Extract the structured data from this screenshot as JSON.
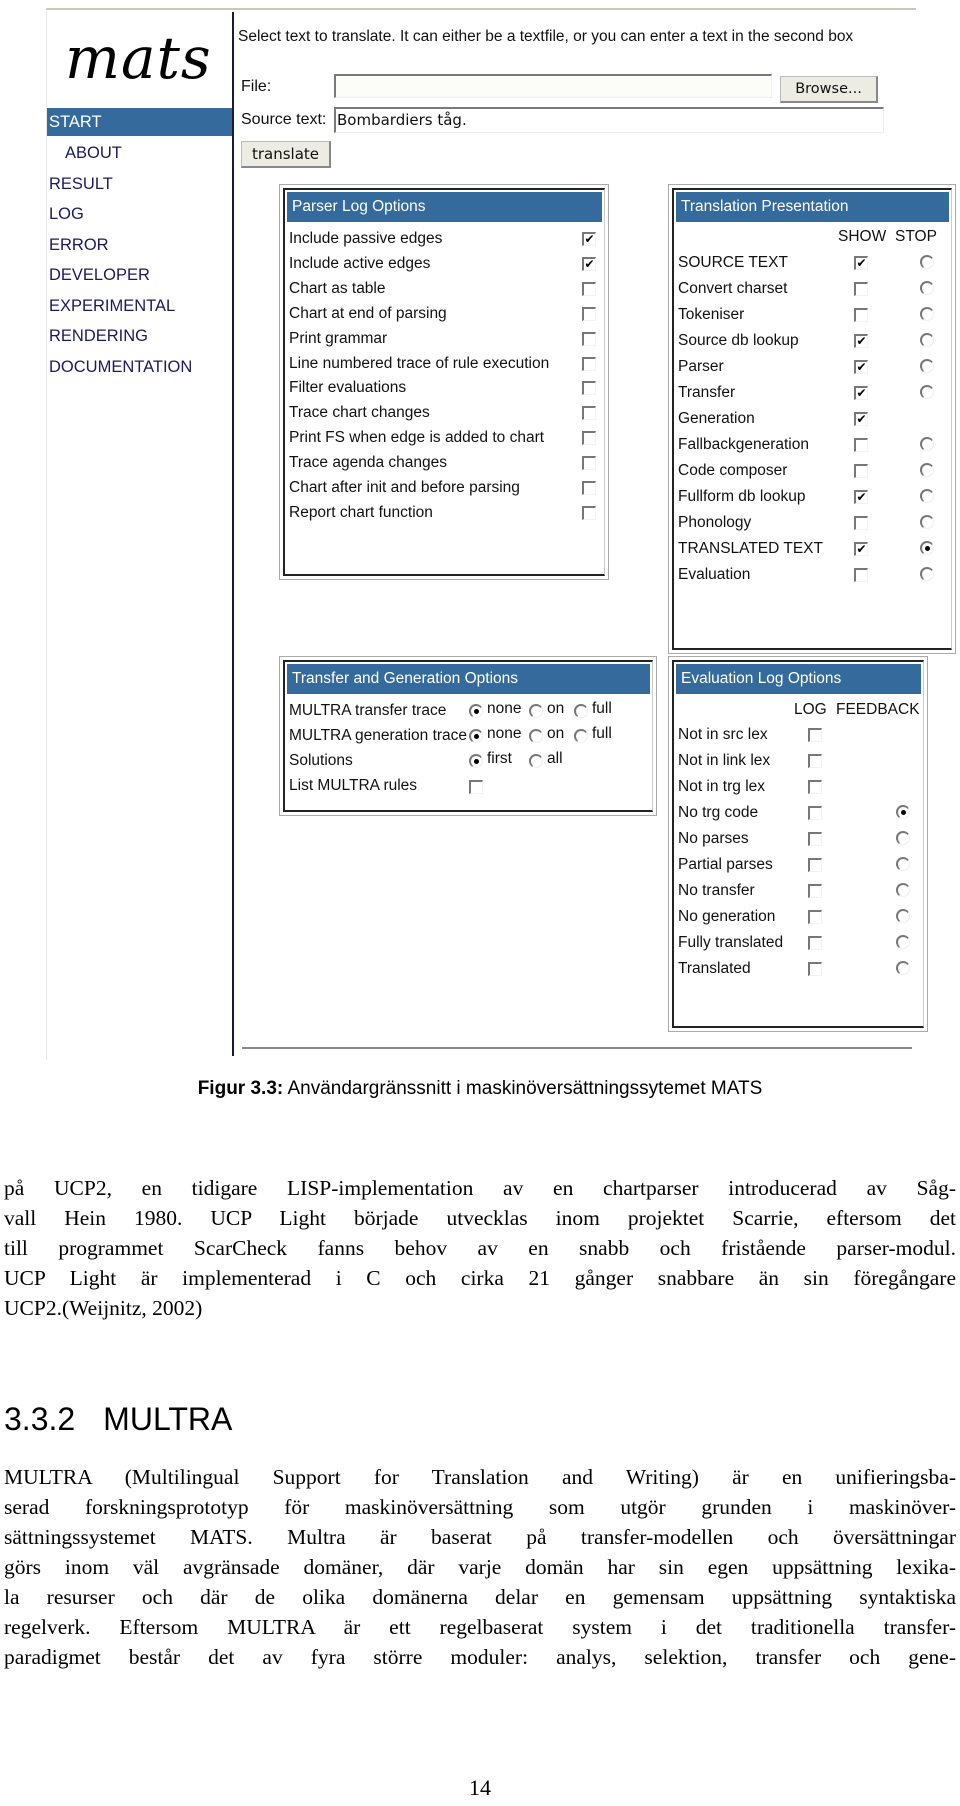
{
  "app": {
    "logo": "mats",
    "nav": [
      {
        "label": "START",
        "active": true
      },
      {
        "label": "ABOUT",
        "indent": true
      },
      {
        "label": "RESULT"
      },
      {
        "label": "LOG"
      },
      {
        "label": "ERROR"
      },
      {
        "label": "DEVELOPER"
      },
      {
        "label": "EXPERIMENTAL"
      },
      {
        "label": "RENDERING"
      },
      {
        "label": "DOCUMENTATION"
      }
    ],
    "intro": "Select text to translate. It can either be a textfile, or you can enter a text in the second box",
    "file_label": "File:",
    "file_value": "",
    "browse_label": "Browse...",
    "source_label": "Source text:",
    "source_value": "Bombardiers tåg.",
    "translate_label": "translate",
    "parser_log": {
      "title": "Parser Log Options",
      "items": [
        {
          "label": "Include passive edges",
          "checked": true
        },
        {
          "label": "Include active edges",
          "checked": true
        },
        {
          "label": "Chart as table",
          "checked": false
        },
        {
          "label": "Chart at end of parsing",
          "checked": false
        },
        {
          "label": "Print grammar",
          "checked": false
        },
        {
          "label": "Line numbered trace of rule execution",
          "checked": false
        },
        {
          "label": "Filter evaluations",
          "checked": false
        },
        {
          "label": "Trace chart changes",
          "checked": false
        },
        {
          "label": "Print FS when edge is added to chart",
          "checked": false
        },
        {
          "label": "Trace agenda changes",
          "checked": false
        },
        {
          "label": "Chart after init and before parsing",
          "checked": false
        },
        {
          "label": "Report chart function",
          "checked": false
        }
      ]
    },
    "translation_presentation": {
      "title": "Translation Presentation",
      "col_show": "SHOW",
      "col_stop": "STOP",
      "items": [
        {
          "label": "SOURCE TEXT",
          "show": true,
          "stop": false,
          "has_stop": true
        },
        {
          "label": "Convert charset",
          "show": false,
          "stop": false,
          "has_stop": true
        },
        {
          "label": "Tokeniser",
          "show": false,
          "stop": false,
          "has_stop": true
        },
        {
          "label": "Source db lookup",
          "show": true,
          "stop": false,
          "has_stop": true
        },
        {
          "label": "Parser",
          "show": true,
          "stop": false,
          "has_stop": true
        },
        {
          "label": "Transfer",
          "show": true,
          "stop": false,
          "has_stop": true
        },
        {
          "label": "Generation",
          "show": true,
          "stop": false,
          "has_stop": false
        },
        {
          "label": "Fallbackgeneration",
          "show": false,
          "stop": false,
          "has_stop": true
        },
        {
          "label": "Code composer",
          "show": false,
          "stop": false,
          "has_stop": true
        },
        {
          "label": "Fullform db lookup",
          "show": true,
          "stop": false,
          "has_stop": true
        },
        {
          "label": "Phonology",
          "show": false,
          "stop": false,
          "has_stop": true
        },
        {
          "label": "TRANSLATED TEXT",
          "show": true,
          "stop": true,
          "has_stop": true
        },
        {
          "label": "Evaluation",
          "show": false,
          "stop": false,
          "has_stop": true
        }
      ]
    },
    "transfer_generation": {
      "title": "Transfer and Generation Options",
      "rows": [
        {
          "label": "MULTRA transfer trace",
          "options": [
            "none",
            "on",
            "full"
          ],
          "selected": "none"
        },
        {
          "label": "MULTRA generation trace",
          "options": [
            "none",
            "on",
            "full"
          ],
          "selected": "none"
        },
        {
          "label": "Solutions",
          "options": [
            "first",
            "all"
          ],
          "selected": "first"
        }
      ],
      "list_rules": {
        "label": "List MULTRA rules",
        "checked": false
      }
    },
    "evaluation_log": {
      "title": "Evaluation Log Options",
      "col_log": "LOG",
      "col_feedback": "FEEDBACK",
      "items": [
        {
          "label": "Not in src lex",
          "log": false,
          "has_feedback": false,
          "feedback": false
        },
        {
          "label": "Not in link lex",
          "log": false,
          "has_feedback": false,
          "feedback": false
        },
        {
          "label": "Not in trg lex",
          "log": false,
          "has_feedback": false,
          "feedback": false
        },
        {
          "label": "No trg code",
          "log": false,
          "has_feedback": true,
          "feedback": true
        },
        {
          "label": "No parses",
          "log": false,
          "has_feedback": true,
          "feedback": false
        },
        {
          "label": "Partial parses",
          "log": false,
          "has_feedback": true,
          "feedback": false
        },
        {
          "label": "No transfer",
          "log": false,
          "has_feedback": true,
          "feedback": false
        },
        {
          "label": "No generation",
          "log": false,
          "has_feedback": true,
          "feedback": false
        },
        {
          "label": "Fully translated",
          "log": false,
          "has_feedback": true,
          "feedback": false
        },
        {
          "label": "Translated",
          "log": false,
          "has_feedback": true,
          "feedback": false
        }
      ]
    }
  },
  "document": {
    "caption_label": "Figur 3.3:",
    "caption_text": " Användargränssnitt i maskinöversättningssytemet MATS",
    "paragraph1": [
      "på UCP2, en tidigare LISP-implementation av en chartparser introducerad av Såg-",
      "vall Hein 1980. UCP Light började utvecklas inom projektet Scarrie, eftersom det",
      "till programmet ScarCheck fanns behov av en snabb och fristående parser-modul.",
      "UCP Light är implementerad i C och cirka 21 gånger snabbare än sin föregångare",
      "UCP2.(Weijnitz, 2002)"
    ],
    "section_number": "3.3.2",
    "section_title": "MULTRA",
    "paragraph2": [
      "MULTRA (Multilingual Support for Translation and Writing) är en unifieringsba-",
      "serad forskningsprototyp för maskinöversättning som utgör grunden i maskinöver-",
      "sättningssystemet MATS. Multra är baserat på transfer-modellen och översättningar",
      "görs inom väl avgränsade domäner, där varje domän har sin egen uppsättning lexika-",
      "la resurser och där de olika domänerna delar en gemensam uppsättning syntaktiska",
      "regelverk. Eftersom MULTRA är ett regelbaserat system i det traditionella transfer-",
      "paradigmet består det av fyra större moduler: analys, selektion, transfer och gene-"
    ],
    "page_number": "14"
  }
}
